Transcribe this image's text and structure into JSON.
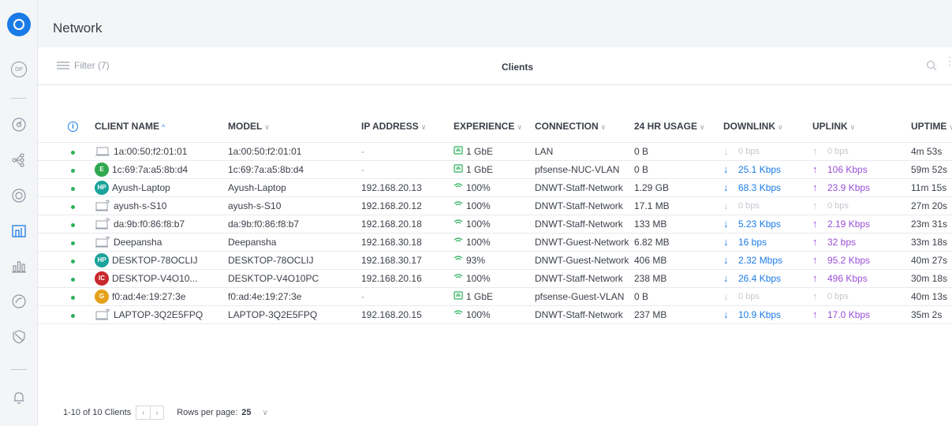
{
  "header": {
    "title": "Network"
  },
  "sidebar": {
    "dp_label": "DP",
    "items": [
      "dashboard-icon",
      "topology-icon",
      "devices-icon",
      "clients-icon",
      "statistics-icon",
      "insights-icon",
      "security-icon",
      "alerts-icon"
    ],
    "active": "clients-icon"
  },
  "toolbar": {
    "filter_label": "Filter (7)",
    "tab_title": "Clients"
  },
  "table": {
    "columns": [
      "CLIENT NAME",
      "MODEL",
      "IP ADDRESS",
      "EXPERIENCE",
      "CONNECTION",
      "24 HR USAGE",
      "DOWNLINK",
      "UPLINK",
      "UPTIME"
    ],
    "sort_indicator": "^",
    "rows": [
      {
        "name": "1a:00:50:f2:01:01",
        "icon": "wired-device-icon",
        "model": "1a:00:50:f2:01:01",
        "ip": "-",
        "experience": "1 GbE",
        "exp_type": "wired",
        "connection": "LAN",
        "usage": "0 B",
        "downlink": "0 bps",
        "uplink": "0 bps",
        "uptime": "4m 53s"
      },
      {
        "name": "1c:69:7a:a5:8b:d4",
        "icon": "avatar",
        "avatar_text": "E",
        "avatar_color": "#2fa84f",
        "model": "1c:69:7a:a5:8b:d4",
        "ip": "-",
        "experience": "1 GbE",
        "exp_type": "wired",
        "connection": "pfsense-NUC-VLAN",
        "usage": "0 B",
        "downlink": "25.1 Kbps",
        "uplink": "106 Kbps",
        "uptime": "59m 52s"
      },
      {
        "name": "Ayush-Laptop",
        "icon": "avatar",
        "avatar_text": "HP",
        "avatar_color": "#1aa39a",
        "model": "Ayush-Laptop",
        "ip": "192.168.20.13",
        "experience": "100%",
        "exp_type": "wifi",
        "connection": "DNWT-Staff-Network",
        "usage": "1.29 GB",
        "downlink": "68.3 Kbps",
        "uplink": "23.9 Kbps",
        "uptime": "11m 15s"
      },
      {
        "name": "ayush-s-S10",
        "icon": "wifi-device-icon",
        "model": "ayush-s-S10",
        "ip": "192.168.20.12",
        "experience": "100%",
        "exp_type": "wifi",
        "connection": "DNWT-Staff-Network",
        "usage": "17.1 MB",
        "downlink": "0 bps",
        "uplink": "0 bps",
        "uptime": "27m 20s"
      },
      {
        "name": "da:9b:f0:86:f8:b7",
        "icon": "wifi-device-icon",
        "model": "da:9b:f0:86:f8:b7",
        "ip": "192.168.20.18",
        "experience": "100%",
        "exp_type": "wifi",
        "connection": "DNWT-Staff-Network",
        "usage": "133 MB",
        "downlink": "5.23 Kbps",
        "uplink": "2.19 Kbps",
        "uptime": "23m 31s"
      },
      {
        "name": "Deepansha",
        "icon": "wifi-device-icon",
        "model": "Deepansha",
        "ip": "192.168.30.18",
        "experience": "100%",
        "exp_type": "wifi",
        "connection": "DNWT-Guest-Network",
        "usage": "6.82 MB",
        "downlink": "16 bps",
        "uplink": "32 bps",
        "uptime": "33m 18s"
      },
      {
        "name": "DESKTOP-78OCLIJ",
        "icon": "avatar",
        "avatar_text": "HP",
        "avatar_color": "#1aa39a",
        "model": "DESKTOP-78OCLIJ",
        "ip": "192.168.30.17",
        "experience": "93%",
        "exp_type": "wifi",
        "connection": "DNWT-Guest-Network",
        "usage": "406 MB",
        "downlink": "2.32 Mbps",
        "uplink": "95.2 Kbps",
        "uptime": "40m 27s"
      },
      {
        "name": "DESKTOP-V4O10...",
        "icon": "avatar",
        "avatar_text": "IC",
        "avatar_color": "#c8282d",
        "model": "DESKTOP-V4O10PC",
        "ip": "192.168.20.16",
        "experience": "100%",
        "exp_type": "wifi",
        "connection": "DNWT-Staff-Network",
        "usage": "238 MB",
        "downlink": "26.4 Kbps",
        "uplink": "496 Kbps",
        "uptime": "30m 18s"
      },
      {
        "name": "f0:ad:4e:19:27:3e",
        "icon": "avatar",
        "avatar_text": "G",
        "avatar_color": "#e5a11b",
        "model": "f0:ad:4e:19:27:3e",
        "ip": "-",
        "experience": "1 GbE",
        "exp_type": "wired",
        "connection": "pfsense-Guest-VLAN",
        "usage": "0 B",
        "downlink": "0 bps",
        "uplink": "0 bps",
        "uptime": "40m 13s"
      },
      {
        "name": "LAPTOP-3Q2E5FPQ",
        "icon": "wifi-device-icon",
        "model": "LAPTOP-3Q2E5FPQ",
        "ip": "192.168.20.15",
        "experience": "100%",
        "exp_type": "wifi",
        "connection": "DNWT-Staff-Network",
        "usage": "237 MB",
        "downlink": "10.9 Kbps",
        "uplink": "17.0 Kbps",
        "uptime": "35m 2s"
      }
    ]
  },
  "footer": {
    "range": "1-10 of 10 Clients",
    "rows_label": "Rows per page:",
    "rows_value": "25"
  },
  "colors": {
    "accent": "#1a7be6",
    "online": "#2cb15b",
    "uplink": "#9a4fd6",
    "muted": "#c3c7ce"
  }
}
